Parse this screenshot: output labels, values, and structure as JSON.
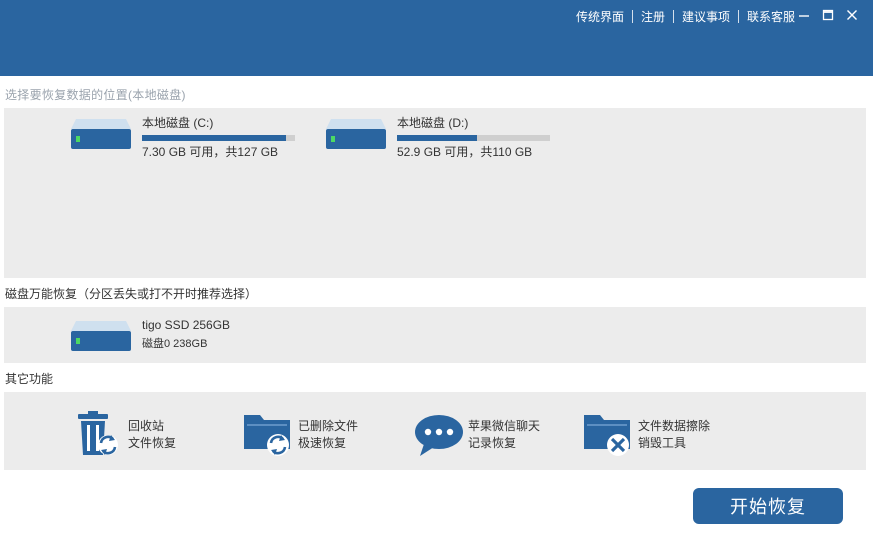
{
  "header": {
    "links": [
      {
        "label": "传统界面"
      },
      {
        "label": "注册"
      },
      {
        "label": "建议事项"
      },
      {
        "label": "联系客服"
      }
    ]
  },
  "window_controls": {
    "minimize_icon": "minimize-icon",
    "maximize_icon": "maximize-icon",
    "close_icon": "close-icon"
  },
  "local_disks": {
    "section_label": "选择要恢复数据的位置(本地磁盘)",
    "disks": [
      {
        "name": "本地磁盘  (C:)",
        "capacity": "7.30 GB 可用，共127 GB",
        "used_fraction": 0.94
      },
      {
        "name": "本地磁盘  (D:)",
        "capacity": "52.9 GB 可用，共110 GB",
        "used_fraction": 0.52
      }
    ]
  },
  "universal_recovery": {
    "section_label": "磁盘万能恢复（分区丢失或打不开时推荐选择）",
    "disks": [
      {
        "name": "tigo SSD 256GB",
        "sub": "磁盘0 238GB"
      }
    ]
  },
  "other_features": {
    "section_label": "其它功能",
    "items": [
      {
        "line1": "回收站",
        "line2": "文件恢复",
        "icon": "recycle-bin-icon"
      },
      {
        "line1": "已删除文件",
        "line2": "极速恢复",
        "icon": "folder-restore-icon"
      },
      {
        "line1": "苹果微信聊天",
        "line2": "记录恢复",
        "icon": "chat-bubble-icon"
      },
      {
        "line1": "文件数据擦除",
        "line2": "销毁工具",
        "icon": "folder-delete-icon"
      }
    ]
  },
  "start_button": {
    "label": "开始恢复"
  },
  "colors": {
    "brand": "#2a65a0",
    "panel": "#ececec",
    "usage_track": "#cfcfcf"
  }
}
